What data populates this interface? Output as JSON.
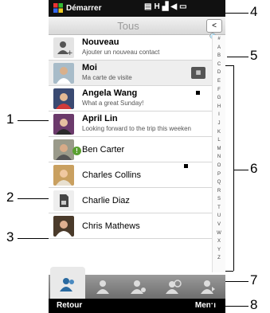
{
  "status": {
    "start": "Démarrer"
  },
  "title": "Tous",
  "contacts": [
    {
      "name": "Nouveau",
      "sub": "Ajouter un nouveau contact",
      "avatar": "add-contact-icon"
    },
    {
      "name": "Moi",
      "sub": "Ma carte de visite",
      "avatar": "me-photo"
    },
    {
      "name": "Angela Wang",
      "sub": "What a great Sunday!",
      "avatar": "angela-photo"
    },
    {
      "name": "April Lin",
      "sub": "Looking forward to the trip this weeken",
      "avatar": "april-photo"
    },
    {
      "name": "Ben Carter",
      "sub": "",
      "avatar": "ben-photo",
      "badge": "!"
    },
    {
      "name": "Charles Collins",
      "sub": "",
      "avatar": "charles-photo"
    },
    {
      "name": "Charlie Diaz",
      "sub": "",
      "avatar": "sim-card-icon"
    },
    {
      "name": "Chris Mathews",
      "sub": "",
      "avatar": "chris-photo"
    }
  ],
  "index_letters": [
    "#",
    "A",
    "B",
    "C",
    "D",
    "E",
    "F",
    "G",
    "H",
    "I",
    "J",
    "K",
    "L",
    "M",
    "N",
    "O",
    "P",
    "Q",
    "R",
    "S",
    "T",
    "U",
    "V",
    "W",
    "X",
    "Y",
    "Z"
  ],
  "softkeys": {
    "left": "Retour",
    "right": "Menu"
  },
  "callouts": {
    "c1": "1",
    "c2": "2",
    "c3": "3",
    "c4": "4",
    "c5": "5",
    "c6": "6",
    "c7": "7",
    "c8": "8"
  }
}
